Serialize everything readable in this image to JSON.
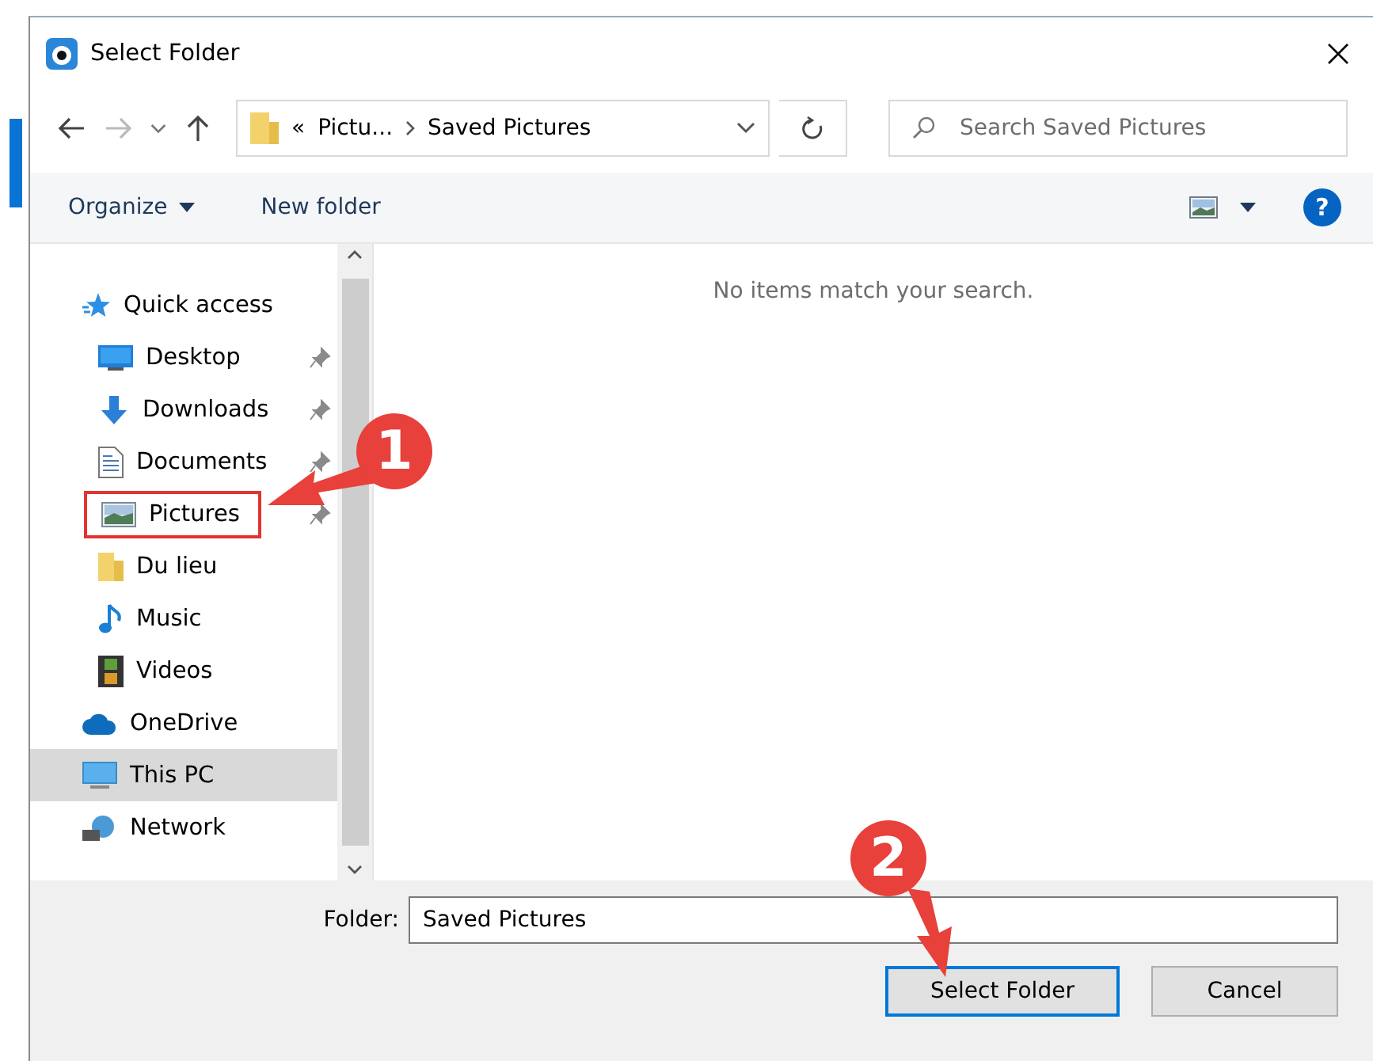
{
  "window": {
    "title": "Select Folder"
  },
  "address_bar": {
    "overflow": "«",
    "segments": [
      "Pictu...",
      "Saved Pictures"
    ]
  },
  "search": {
    "placeholder": "Search Saved Pictures"
  },
  "toolbar": {
    "organize": "Organize",
    "new_folder": "New folder",
    "help": "?"
  },
  "sidebar": {
    "items": [
      {
        "label": "Quick access",
        "kind": "star",
        "selected": false,
        "pinned": false,
        "highlighted": false,
        "children": [
          {
            "label": "Desktop",
            "kind": "desktop",
            "selected": false,
            "pinned": true,
            "highlighted": false
          },
          {
            "label": "Downloads",
            "kind": "download",
            "selected": false,
            "pinned": true,
            "highlighted": false
          },
          {
            "label": "Documents",
            "kind": "document",
            "selected": false,
            "pinned": true,
            "highlighted": false
          },
          {
            "label": "Pictures",
            "kind": "pictures",
            "selected": false,
            "pinned": true,
            "highlighted": true
          },
          {
            "label": "Du lieu",
            "kind": "folder",
            "selected": false,
            "pinned": false,
            "highlighted": false
          },
          {
            "label": "Music",
            "kind": "music",
            "selected": false,
            "pinned": false,
            "highlighted": false
          },
          {
            "label": "Videos",
            "kind": "video",
            "selected": false,
            "pinned": false,
            "highlighted": false
          }
        ]
      },
      {
        "label": "OneDrive",
        "kind": "cloud",
        "selected": false,
        "pinned": false,
        "highlighted": false
      },
      {
        "label": "This PC",
        "kind": "computer",
        "selected": true,
        "pinned": false,
        "highlighted": false
      },
      {
        "label": "Network",
        "kind": "network",
        "selected": false,
        "pinned": false,
        "highlighted": false
      }
    ]
  },
  "content": {
    "empty_message": "No items match your search."
  },
  "footer": {
    "folder_label": "Folder:",
    "folder_value": "Saved Pictures",
    "buttons": [
      {
        "label": "Select Folder",
        "default": true
      },
      {
        "label": "Cancel",
        "default": false
      }
    ]
  },
  "annotations": [
    {
      "label": "1"
    },
    {
      "label": "2"
    }
  ]
}
